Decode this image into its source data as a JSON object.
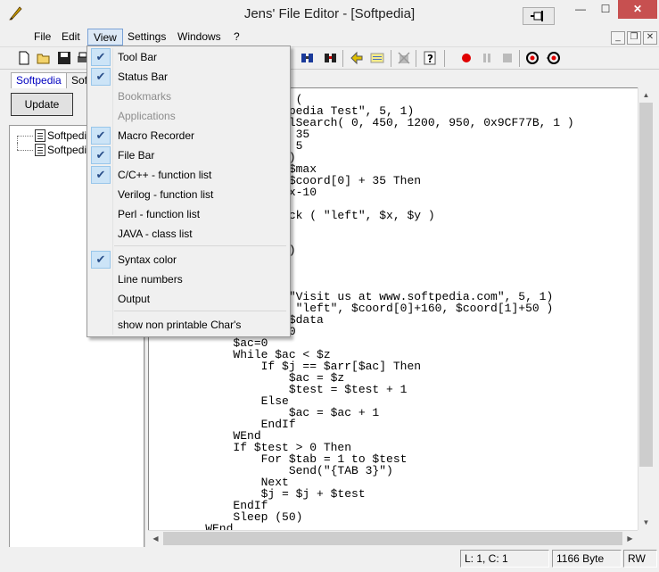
{
  "window": {
    "title": "Jens' File Editor - [Softpedia]",
    "minimize_label": "—",
    "maximize_label": "☐",
    "close_label": "✕"
  },
  "menubar": {
    "items": [
      "File",
      "Edit",
      "View",
      "Settings",
      "Windows",
      "?"
    ],
    "active": "View"
  },
  "left_panel": {
    "tabs": [
      "Softpedia",
      "Sof"
    ],
    "update_label": "Update",
    "tree_items": [
      "Softpedia",
      "Softpedia"
    ]
  },
  "view_menu": {
    "items": [
      {
        "label": "Tool Bar",
        "checked": true,
        "disabled": false
      },
      {
        "label": "Status Bar",
        "checked": true,
        "disabled": false
      },
      {
        "label": "Bookmarks",
        "checked": false,
        "disabled": true
      },
      {
        "label": "Applications",
        "checked": false,
        "disabled": true
      },
      {
        "label": "Macro Recorder",
        "checked": true,
        "disabled": false
      },
      {
        "label": "File Bar",
        "checked": true,
        "disabled": false
      },
      {
        "label": "C/C++ - function list",
        "checked": true,
        "disabled": false
      },
      {
        "label": "Verilog - function list",
        "checked": false,
        "disabled": false
      },
      {
        "label": "Perl - function list",
        "checked": false,
        "disabled": false
      },
      {
        "label": "JAVA - class list",
        "checked": false,
        "disabled": false
      },
      {
        "label": "Syntax color",
        "checked": true,
        "disabled": false
      },
      {
        "label": "Line numbers",
        "checked": false,
        "disabled": false
      },
      {
        "label": "Output",
        "checked": false,
        "disabled": false
      },
      {
        "label": "show non printable Char's",
        "checked": false,
        "disabled": false
      }
    ]
  },
  "editor": {
    "lines": [
      "                 (",
      "               tpedia Test\", 5, 1)",
      "               elSearch( 0, 450, 1200, 950, 0x9CF77B, 1 )",
      "                 35",
      "                 5",
      "                )",
      "                $max",
      "                $coord[0] + 35 Then",
      "                x-10",
      "",
      "                ck ( \"left\", $x, $y )",
      "",
      "",
      "                )",
      "",
      "",
      "",
      "                \"Visit us at www.softpedia.com\", 5, 1)",
      "                 \"left\", $coord[0]+160, $coord[1]+50 )",
      "                $data",
      "                0",
      "        $ac=0",
      "        While $ac < $z",
      "            If $j == $arr[$ac] Then",
      "                $ac = $z",
      "                $test = $test + 1",
      "            Else",
      "                $ac = $ac + 1",
      "            EndIf",
      "        WEnd",
      "        If $test > 0 Then",
      "            For $tab = 1 to $test",
      "                Send(\"{TAB 3}\")",
      "            Next",
      "            $j = $j + $test",
      "        EndIf",
      "        Sleep (50)",
      "    WEnd"
    ]
  },
  "statusbar": {
    "position": "L: 1, C: 1",
    "size": "1166 Byte",
    "mode": "RW"
  },
  "colors": {
    "check_bg": "#cce4f7",
    "menu_active": "#dde9f6",
    "record_red": "#e00000"
  }
}
